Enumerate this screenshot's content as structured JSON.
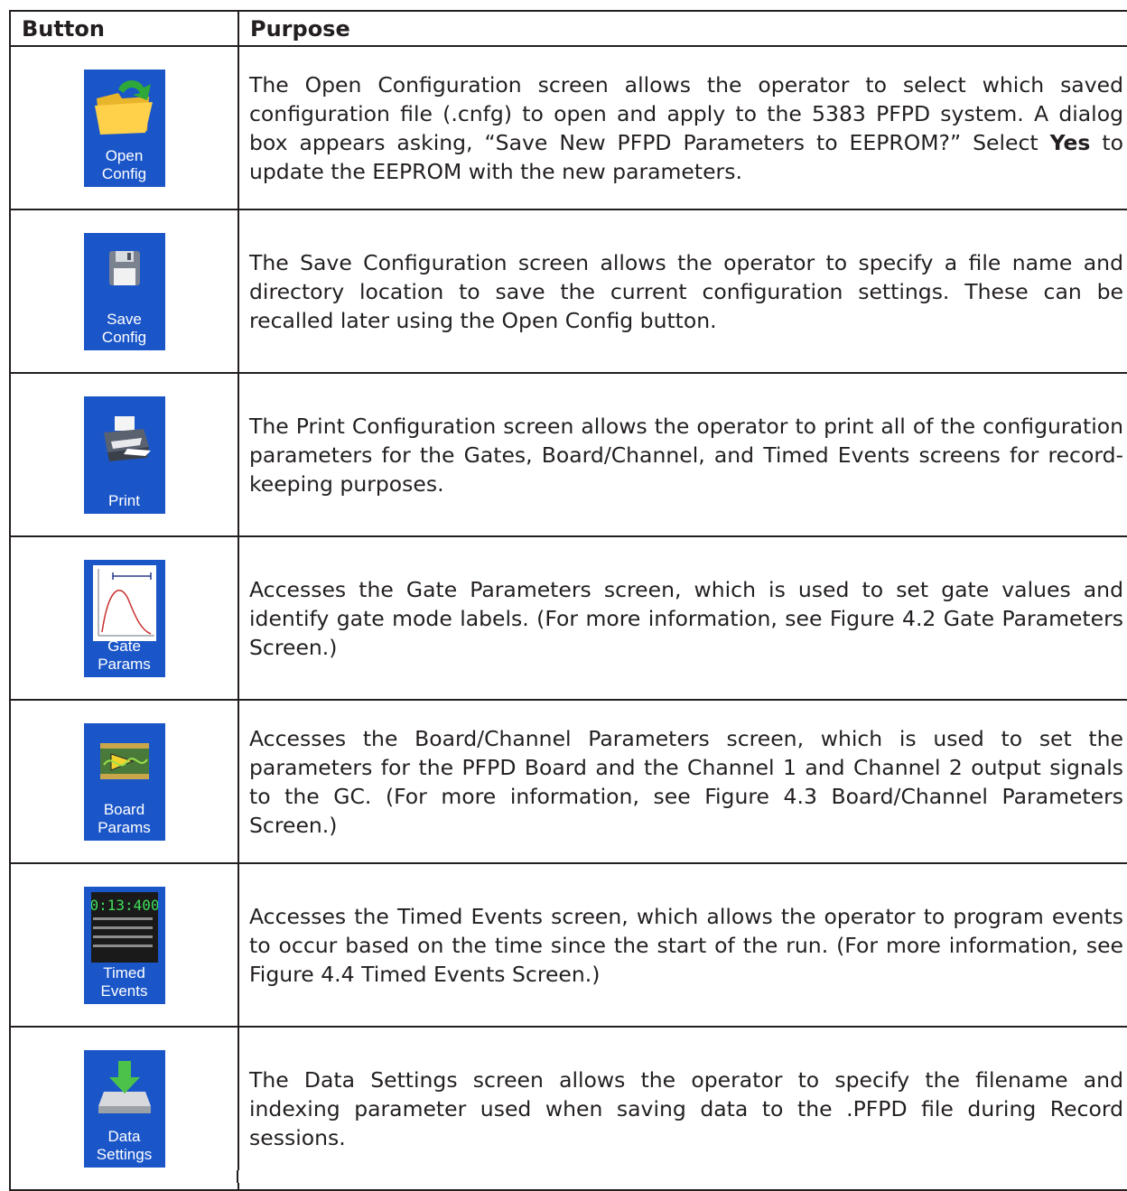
{
  "table": {
    "headers": {
      "button": "Button",
      "purpose": "Purpose"
    },
    "rows": [
      {
        "icon": "open-folder-icon",
        "label1": "Open",
        "label2": "Config",
        "desc_a": "The Open Configuration screen allows the operator to select which saved configuration file (.cnfg) to open and apply to the 5383 PFPD system. A dialog box appears asking, “Save New PFPD Parameters to EEPROM?” Select ",
        "desc_bold": "Yes",
        "desc_b": " to update the EEPROM with the new parameters."
      },
      {
        "icon": "floppy-disk-icon",
        "label1": "Save",
        "label2": "Config",
        "desc": "The Save Configuration screen allows the operator to specify a file name and directory location to save the current configuration settings. These can be recalled later using the Open Config button."
      },
      {
        "icon": "printer-icon",
        "label1": "Print",
        "desc": "The Print Configuration screen allows the operator to print all of the configuration parameters for the Gates, Board/Channel, and Timed Events screens for record-keeping purposes."
      },
      {
        "icon": "gate-chart-icon",
        "label1": "Gate",
        "label2": "Params",
        "desc": "Accesses the Gate Parameters screen, which is used to set gate values and identify gate mode labels. (For more information, see Figure 4.2 Gate Parameters Screen.)"
      },
      {
        "icon": "circuit-board-icon",
        "label1": "Board",
        "label2": "Params",
        "desc": "Accesses the Board/Channel Parameters screen, which is used to set the parameters for the PFPD Board and the Channel 1 and Channel 2 output signals to the GC. (For more information, see Figure 4.3 Board/Channel Parameters Screen.)"
      },
      {
        "icon": "timer-display-icon",
        "label1": "Timed",
        "label2": "Events",
        "timer": "0:13:400",
        "desc": "Accesses the Timed Events screen, which allows the operator to program events to occur based on the time since the start of the run. (For more information, see Figure 4.4 Timed Events Screen.)"
      },
      {
        "icon": "download-tray-icon",
        "label1": "Data",
        "label2": "Settings",
        "desc": "The Data Settings screen allows the operator to specify the filename and indexing parameter used when saving data to the .PFPD file during Record sessions."
      }
    ]
  }
}
